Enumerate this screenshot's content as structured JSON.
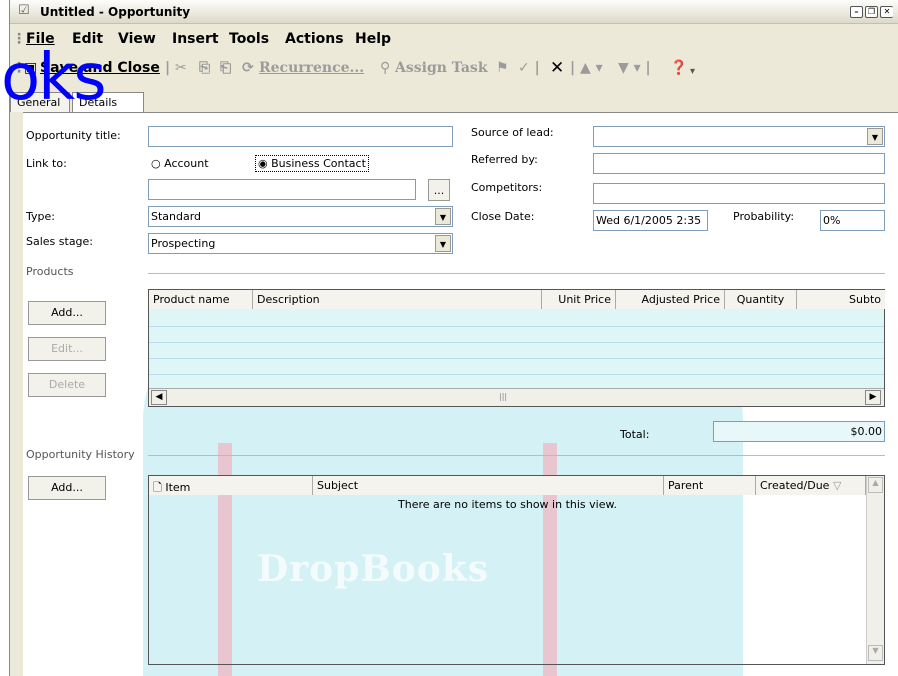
{
  "window": {
    "title": "Untitled - Opportunity",
    "controls": [
      "minimize-icon",
      "restore-icon",
      "close-icon"
    ]
  },
  "menu": [
    "File",
    "Edit",
    "View",
    "Insert",
    "Tools",
    "Actions",
    "Help"
  ],
  "toolbar": {
    "save_close": "Save and Close",
    "recurrence": "Recurrence...",
    "assign_task": "Assign Task"
  },
  "watermark": {
    "top": "oks",
    "bottom": "DropBooks"
  },
  "tabs": [
    "General",
    "Details"
  ],
  "form": {
    "opportunity_title_label": "Opportunity title:",
    "opportunity_title_value": "",
    "link_to_label": "Link to:",
    "account_label": "Account",
    "business_contact_label": "Business Contact",
    "link_value": "",
    "browse_label": "...",
    "type_label": "Type:",
    "type_value": "Standard",
    "sales_stage_label": "Sales stage:",
    "sales_stage_value": "Prospecting",
    "source_label": "Source of lead:",
    "source_value": "",
    "referred_label": "Referred by:",
    "competitors_label": "Competitors:",
    "close_date_label": "Close Date:",
    "close_date_value": "Wed 6/1/2005 2:35",
    "probability_label": "Probability:",
    "probability_value": "0%"
  },
  "products": {
    "section_label": "Products",
    "add": "Add...",
    "edit": "Edit...",
    "delete": "Delete",
    "columns": [
      "Product name",
      "Description",
      "Unit Price",
      "Adjusted Price",
      "Quantity",
      "Subto"
    ],
    "total_label": "Total:",
    "total_value": "$0.00"
  },
  "history": {
    "section_label": "Opportunity History",
    "add": "Add...",
    "columns": [
      "Item",
      "Subject",
      "Parent",
      "Created/Due"
    ],
    "empty": "There are no items to show in this view."
  }
}
